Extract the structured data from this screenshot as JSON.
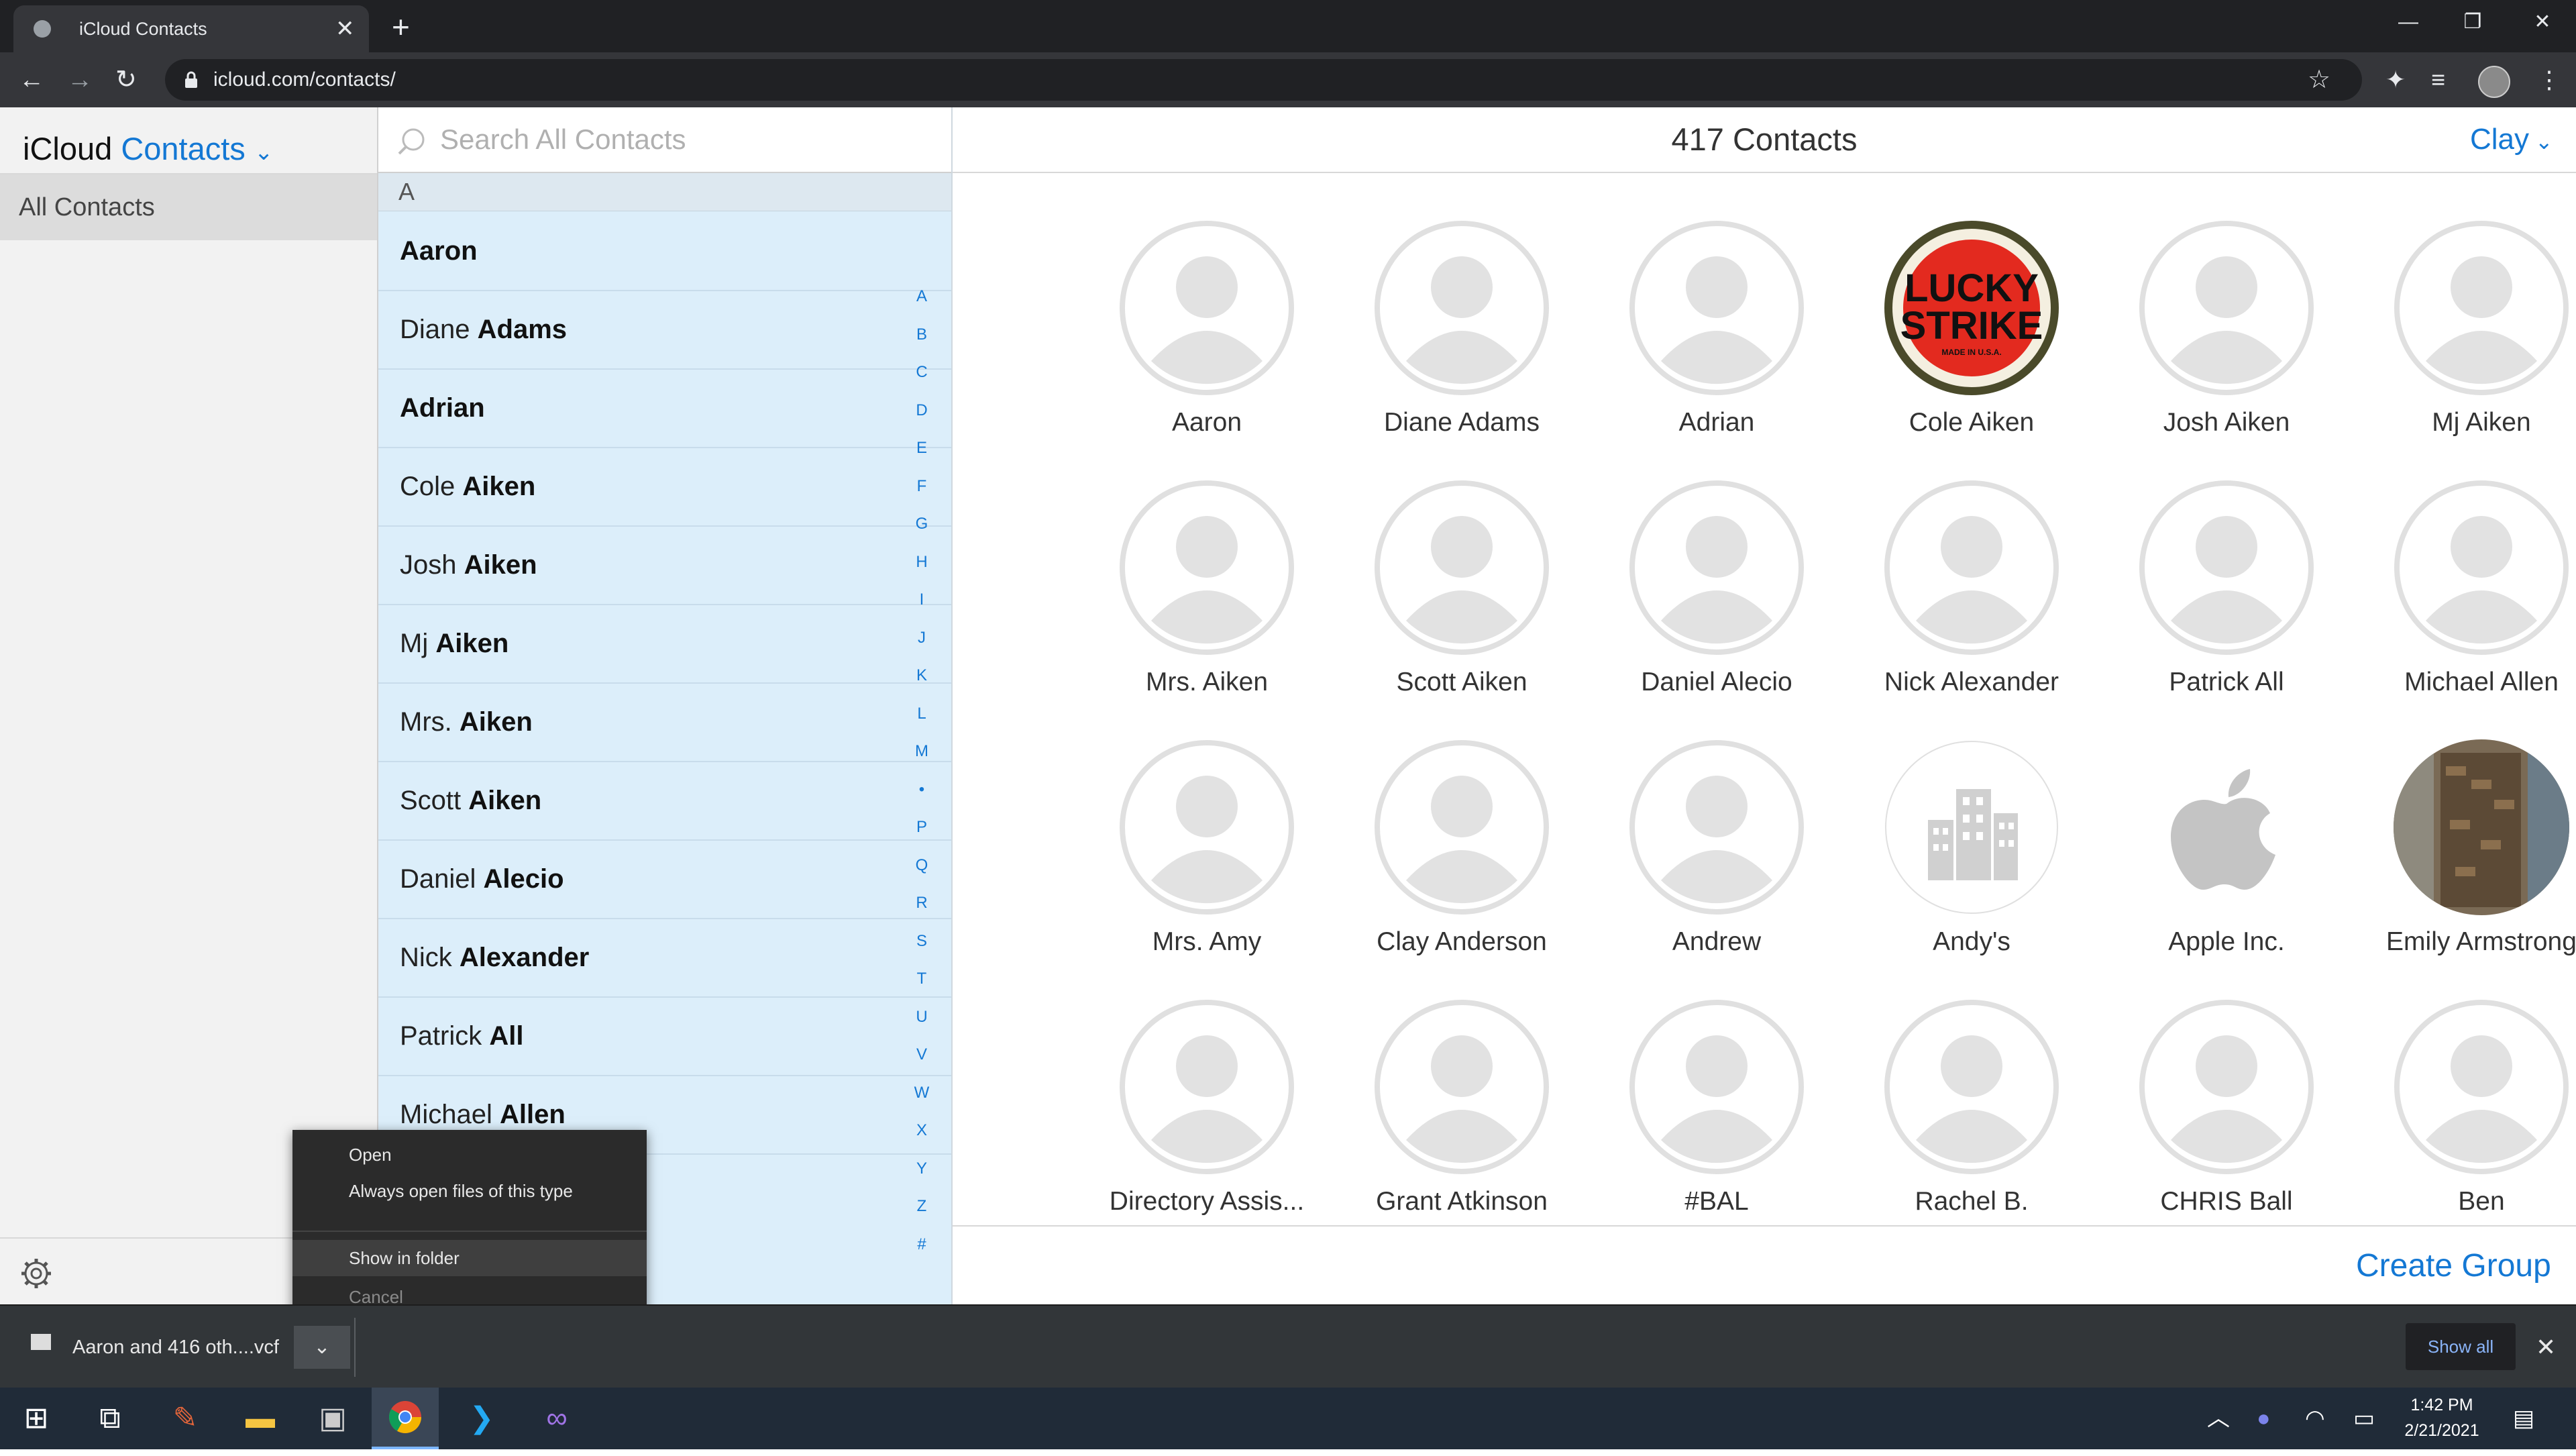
{
  "browser": {
    "tab_title": "iCloud Contacts",
    "tab_close": "✕",
    "new_tab": "+",
    "url": "icloud.com/contacts/",
    "window_controls": {
      "minimize": "—",
      "restore": "❐",
      "close": "✕"
    }
  },
  "sidebar": {
    "brand_prefix": "iCloud",
    "brand_app": "Contacts",
    "brand_chevron": "⌄",
    "all_contacts": "All Contacts"
  },
  "list": {
    "search_placeholder": "Search All Contacts",
    "section_letter": "A",
    "rows": [
      {
        "first": "",
        "last": "Aaron"
      },
      {
        "first": "Diane ",
        "last": "Adams"
      },
      {
        "first": "",
        "last": "Adrian"
      },
      {
        "first": "Cole ",
        "last": "Aiken"
      },
      {
        "first": "Josh ",
        "last": "Aiken"
      },
      {
        "first": "Mj ",
        "last": "Aiken"
      },
      {
        "first": "Mrs. ",
        "last": "Aiken"
      },
      {
        "first": "Scott ",
        "last": "Aiken"
      },
      {
        "first": "Daniel ",
        "last": "Alecio"
      },
      {
        "first": "Nick ",
        "last": "Alexander"
      },
      {
        "first": "Patrick ",
        "last": "All"
      },
      {
        "first": "Michael ",
        "last": "Allen"
      }
    ],
    "index_letters": [
      "A",
      "B",
      "C",
      "D",
      "E",
      "F",
      "G",
      "H",
      "I",
      "J",
      "K",
      "L",
      "M",
      "•",
      "P",
      "Q",
      "R",
      "S",
      "T",
      "U",
      "V",
      "W",
      "X",
      "Y",
      "Z",
      "#"
    ]
  },
  "main": {
    "contact_count": "417 Contacts",
    "user_name": "Clay",
    "create_group": "Create Group",
    "cards": [
      {
        "name": "Aaron",
        "avatar": "placeholder"
      },
      {
        "name": "Diane Adams",
        "avatar": "placeholder"
      },
      {
        "name": "Adrian",
        "avatar": "placeholder"
      },
      {
        "name": "Cole Aiken",
        "avatar": "lucky-strike-logo",
        "logo_text_1": "LUCKY",
        "logo_text_2": "STRIKE",
        "logo_text_3": "MADE IN U.S.A."
      },
      {
        "name": "Josh Aiken",
        "avatar": "placeholder"
      },
      {
        "name": "Mj Aiken",
        "avatar": "placeholder"
      },
      {
        "name": "Mrs. Aiken",
        "avatar": "placeholder"
      },
      {
        "name": "Scott Aiken",
        "avatar": "placeholder"
      },
      {
        "name": "Daniel Alecio",
        "avatar": "placeholder"
      },
      {
        "name": "Nick Alexander",
        "avatar": "placeholder"
      },
      {
        "name": "Patrick All",
        "avatar": "placeholder"
      },
      {
        "name": "Michael Allen",
        "avatar": "placeholder"
      },
      {
        "name": "Mrs. Amy",
        "avatar": "placeholder"
      },
      {
        "name": "Clay Anderson",
        "avatar": "placeholder"
      },
      {
        "name": "Andrew",
        "avatar": "placeholder"
      },
      {
        "name": "Andy's",
        "avatar": "building-icon"
      },
      {
        "name": "Apple Inc.",
        "avatar": "apple-logo"
      },
      {
        "name": "Emily Armstrong",
        "avatar": "photo"
      },
      {
        "name": "Directory Assis...",
        "avatar": "placeholder"
      },
      {
        "name": "Grant Atkinson",
        "avatar": "placeholder"
      },
      {
        "name": "#BAL",
        "avatar": "placeholder"
      },
      {
        "name": "Rachel B.",
        "avatar": "placeholder"
      },
      {
        "name": "CHRIS Ball",
        "avatar": "placeholder"
      },
      {
        "name": "Ben",
        "avatar": "placeholder"
      }
    ]
  },
  "context_menu": {
    "items": [
      "Open",
      "Always open files of this type",
      "Show in folder",
      "Cancel"
    ],
    "highlighted": "Show in folder"
  },
  "download_shelf": {
    "file_name": "Aaron and 416 oth....vcf",
    "show_all": "Show all",
    "close": "✕"
  },
  "taskbar": {
    "time": "1:42 PM",
    "date": "2/21/2021"
  },
  "colors": {
    "accent": "#1478d4",
    "list_bg": "#dceefa",
    "sidebar_bg": "#f2f2f2",
    "chrome_dark": "#202124"
  }
}
